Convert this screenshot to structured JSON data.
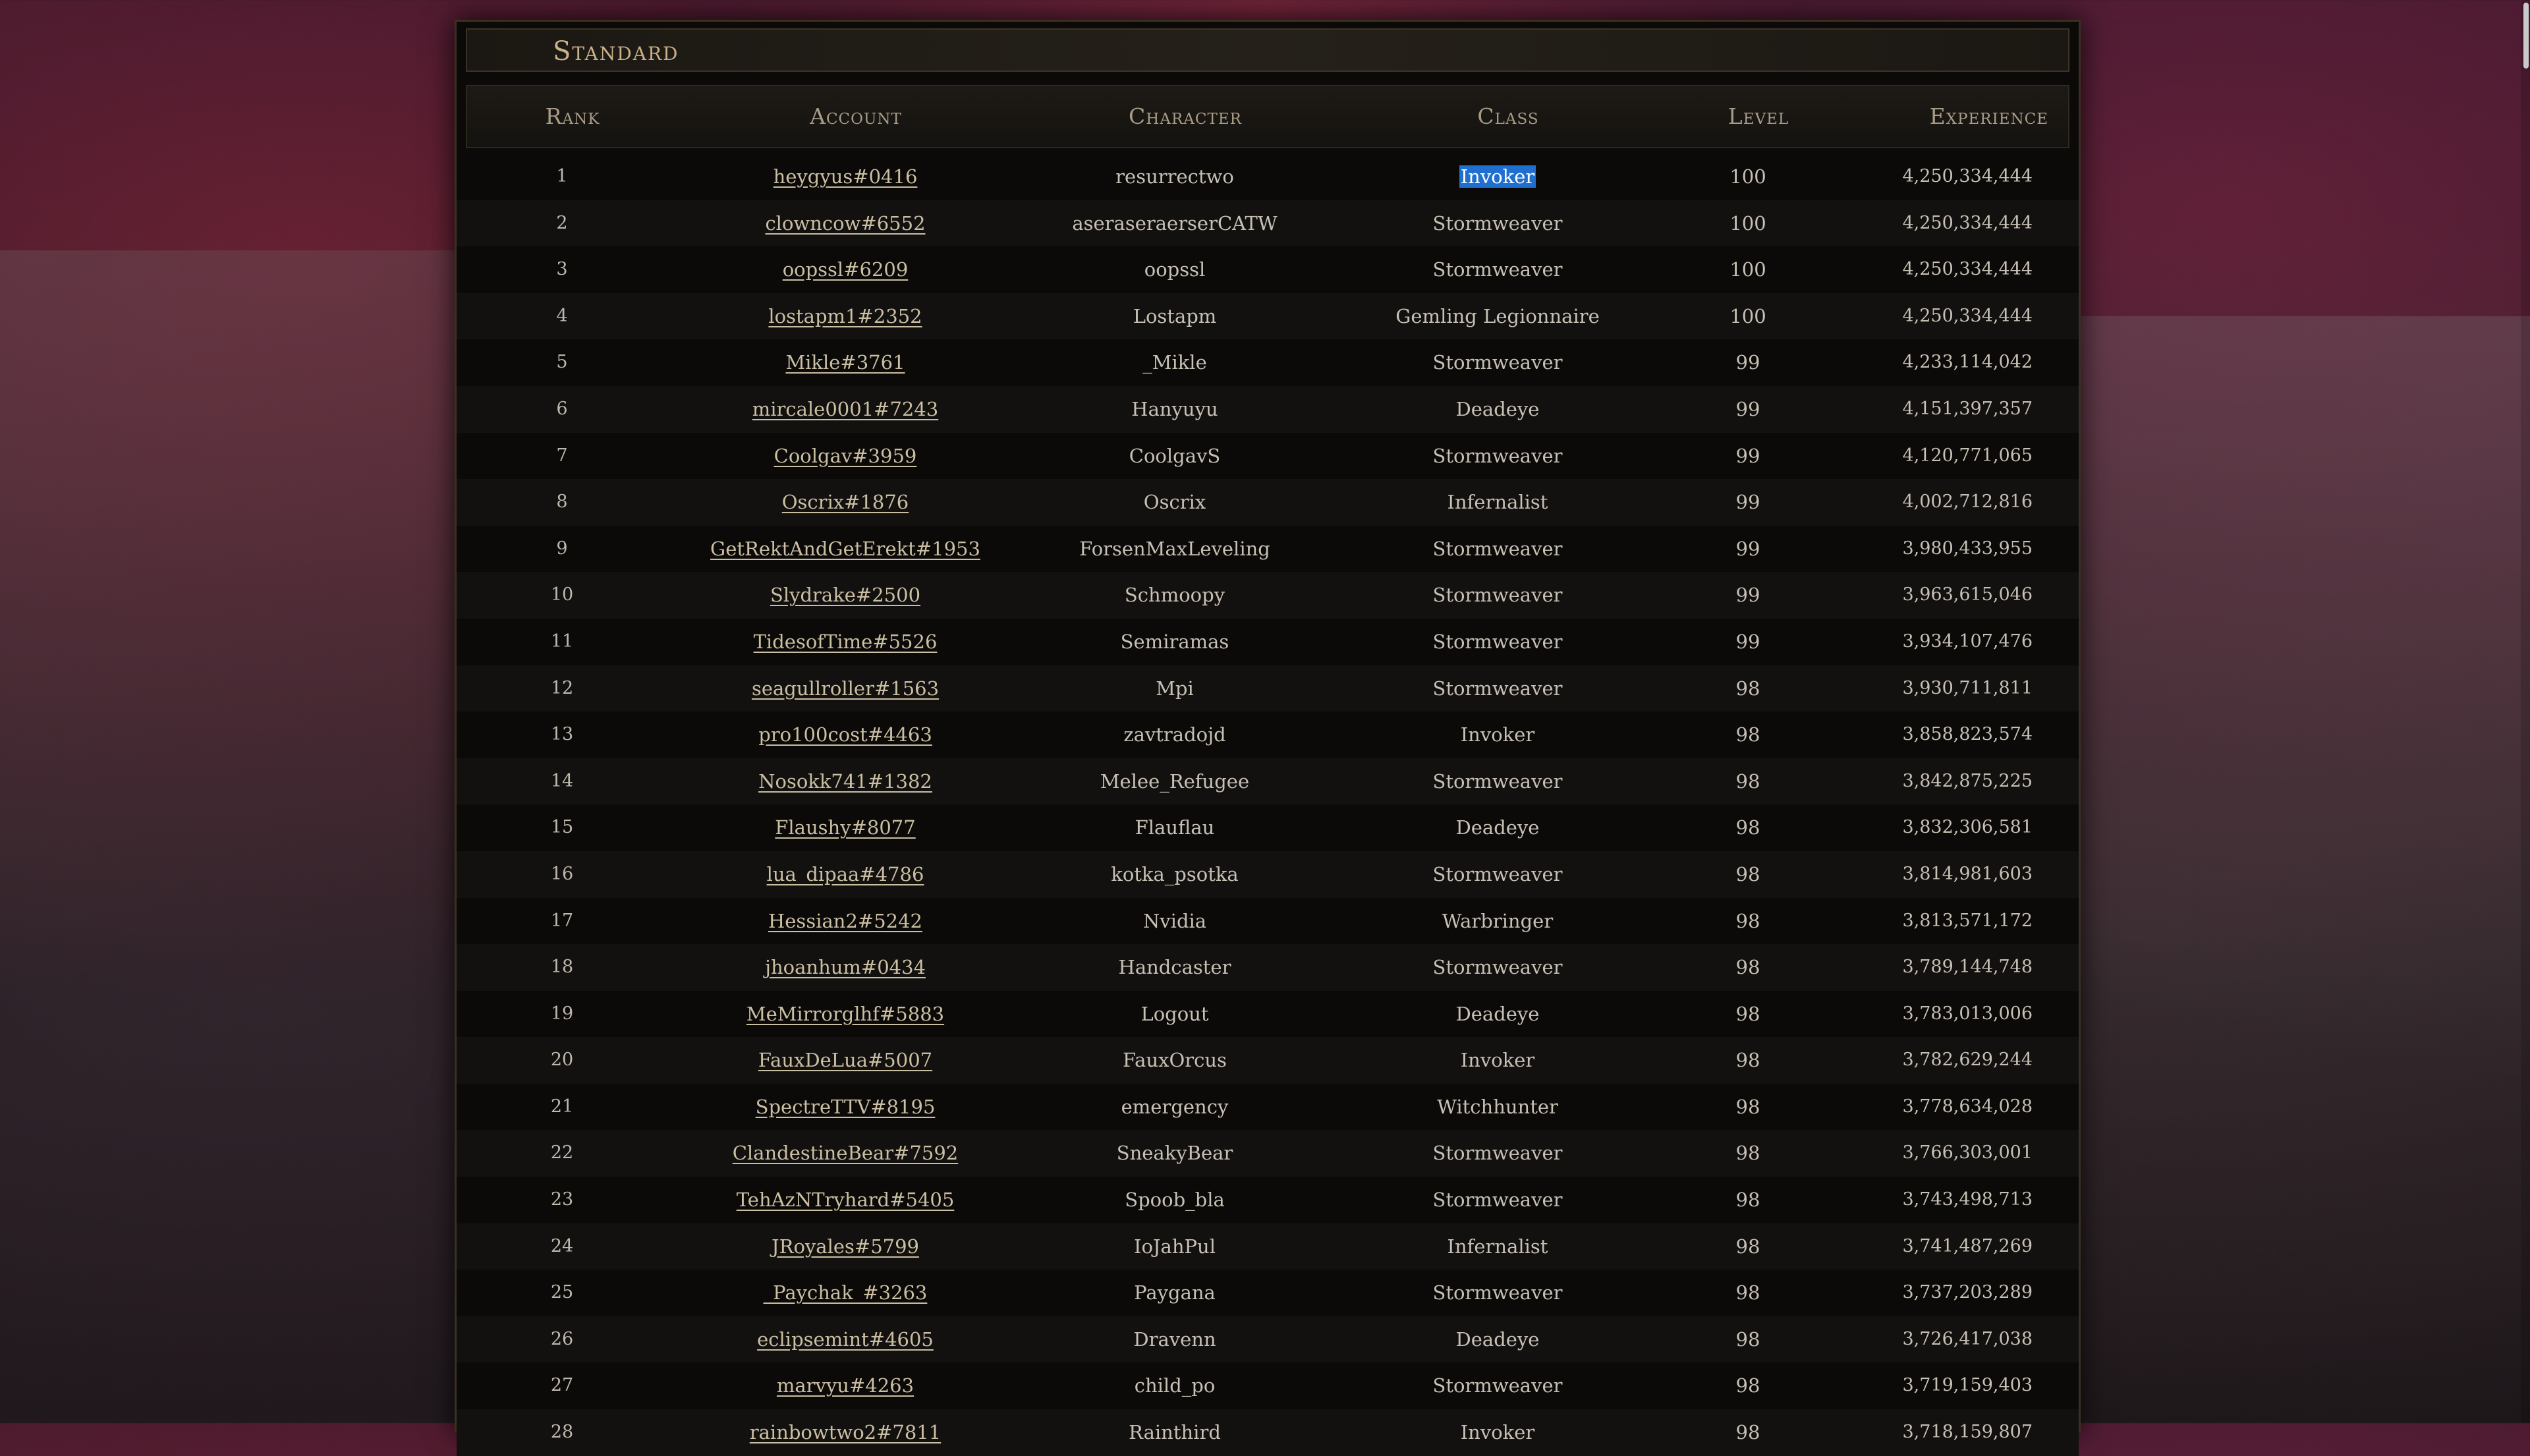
{
  "title": "Standard",
  "columns": {
    "rank": "Rank",
    "account": "Account",
    "character": "Character",
    "class": "Class",
    "level": "Level",
    "experience": "Experience"
  },
  "rows": [
    {
      "rank": "1",
      "account": "heygyus#0416",
      "character": "resurrectwo",
      "class": "Invoker",
      "level": "100",
      "experience": "4,250,334,444",
      "selected_class": true
    },
    {
      "rank": "2",
      "account": "clowncow#6552",
      "character": "aseraseraerserCATW",
      "class": "Stormweaver",
      "level": "100",
      "experience": "4,250,334,444"
    },
    {
      "rank": "3",
      "account": "oopssl#6209",
      "character": "oopssl",
      "class": "Stormweaver",
      "level": "100",
      "experience": "4,250,334,444"
    },
    {
      "rank": "4",
      "account": "lostapm1#2352",
      "character": "Lostapm",
      "class": "Gemling Legionnaire",
      "level": "100",
      "experience": "4,250,334,444"
    },
    {
      "rank": "5",
      "account": "Mikle#3761",
      "character": "_Mikle",
      "class": "Stormweaver",
      "level": "99",
      "experience": "4,233,114,042"
    },
    {
      "rank": "6",
      "account": "mircale0001#7243",
      "character": "Hanyuyu",
      "class": "Deadeye",
      "level": "99",
      "experience": "4,151,397,357"
    },
    {
      "rank": "7",
      "account": "Coolgav#3959",
      "character": "CoolgavS",
      "class": "Stormweaver",
      "level": "99",
      "experience": "4,120,771,065"
    },
    {
      "rank": "8",
      "account": "Oscrix#1876",
      "character": "Oscrix",
      "class": "Infernalist",
      "level": "99",
      "experience": "4,002,712,816"
    },
    {
      "rank": "9",
      "account": "GetRektAndGetErekt#1953",
      "character": "ForsenMaxLeveling",
      "class": "Stormweaver",
      "level": "99",
      "experience": "3,980,433,955"
    },
    {
      "rank": "10",
      "account": "Slydrake#2500",
      "character": "Schmoopy",
      "class": "Stormweaver",
      "level": "99",
      "experience": "3,963,615,046"
    },
    {
      "rank": "11",
      "account": "TidesofTime#5526",
      "character": "Semiramas",
      "class": "Stormweaver",
      "level": "99",
      "experience": "3,934,107,476"
    },
    {
      "rank": "12",
      "account": "seagullroller#1563",
      "character": "Mpi",
      "class": "Stormweaver",
      "level": "98",
      "experience": "3,930,711,811"
    },
    {
      "rank": "13",
      "account": "pro100cost#4463",
      "character": "zavtradojd",
      "class": "Invoker",
      "level": "98",
      "experience": "3,858,823,574"
    },
    {
      "rank": "14",
      "account": "Nosokk741#1382",
      "character": "Melee_Refugee",
      "class": "Stormweaver",
      "level": "98",
      "experience": "3,842,875,225"
    },
    {
      "rank": "15",
      "account": "Flaushy#8077",
      "character": "Flauflau",
      "class": "Deadeye",
      "level": "98",
      "experience": "3,832,306,581"
    },
    {
      "rank": "16",
      "account": "lua_dipaa#4786",
      "character": "kotka_psotka",
      "class": "Stormweaver",
      "level": "98",
      "experience": "3,814,981,603"
    },
    {
      "rank": "17",
      "account": "Hessian2#5242",
      "character": "Nvidia",
      "class": "Warbringer",
      "level": "98",
      "experience": "3,813,571,172"
    },
    {
      "rank": "18",
      "account": "jhoanhum#0434",
      "character": "Handcaster",
      "class": "Stormweaver",
      "level": "98",
      "experience": "3,789,144,748"
    },
    {
      "rank": "19",
      "account": "MeMirrorglhf#5883",
      "character": "Logout",
      "class": "Deadeye",
      "level": "98",
      "experience": "3,783,013,006"
    },
    {
      "rank": "20",
      "account": "FauxDeLua#5007",
      "character": "FauxOrcus",
      "class": "Invoker",
      "level": "98",
      "experience": "3,782,629,244"
    },
    {
      "rank": "21",
      "account": "SpectreTTV#8195",
      "character": "emergency",
      "class": "Witchhunter",
      "level": "98",
      "experience": "3,778,634,028"
    },
    {
      "rank": "22",
      "account": "ClandestineBear#7592",
      "character": "SneakyBear",
      "class": "Stormweaver",
      "level": "98",
      "experience": "3,766,303,001"
    },
    {
      "rank": "23",
      "account": "TehAzNTryhard#5405",
      "character": "Spoob_bla",
      "class": "Stormweaver",
      "level": "98",
      "experience": "3,743,498,713"
    },
    {
      "rank": "24",
      "account": "JRoyales#5799",
      "character": "IoJahPul",
      "class": "Infernalist",
      "level": "98",
      "experience": "3,741,487,269"
    },
    {
      "rank": "25",
      "account": "_Paychak_#3263",
      "character": "Paygana",
      "class": "Stormweaver",
      "level": "98",
      "experience": "3,737,203,289"
    },
    {
      "rank": "26",
      "account": "eclipsemint#4605",
      "character": "Dravenn",
      "class": "Deadeye",
      "level": "98",
      "experience": "3,726,417,038"
    },
    {
      "rank": "27",
      "account": "marvyu#4263",
      "character": "child_po",
      "class": "Stormweaver",
      "level": "98",
      "experience": "3,719,159,403"
    },
    {
      "rank": "28",
      "account": "rainbowtwo2#7811",
      "character": "Rainthird",
      "class": "Invoker",
      "level": "98",
      "experience": "3,718,159,807"
    }
  ]
}
